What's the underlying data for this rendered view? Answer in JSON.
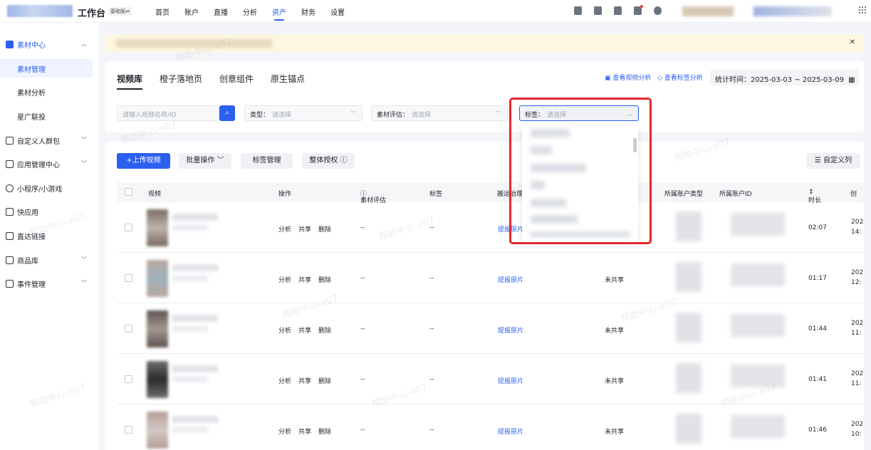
{
  "app": {
    "title": "工作台",
    "version_badge": "基础版⇌"
  },
  "nav": [
    "首页",
    "账户",
    "直播",
    "分析",
    "资产",
    "财务",
    "设置"
  ],
  "nav_active": "资产",
  "sidebar": {
    "items": [
      {
        "label": "素材中心",
        "icon": "material-icon",
        "expanded": true
      },
      {
        "label": "自定义人群包",
        "icon": "audience-icon"
      },
      {
        "label": "应用管理中心",
        "icon": "app-icon"
      },
      {
        "label": "小程序/小游戏",
        "icon": "miniapp-icon"
      },
      {
        "label": "快应用",
        "icon": "quickapp-icon"
      },
      {
        "label": "直达链接",
        "icon": "link-icon"
      },
      {
        "label": "商品库",
        "icon": "product-icon"
      },
      {
        "label": "事件管理",
        "icon": "event-icon"
      }
    ],
    "sub": [
      "素材管理",
      "素材分析",
      "星广联投"
    ],
    "sub_active": "素材管理"
  },
  "tabs": [
    "视频库",
    "橙子落地页",
    "创意组件",
    "原生锚点"
  ],
  "links": {
    "video_analysis": "查看视频分析",
    "tag_analysis": "查看标签分析"
  },
  "stat": {
    "label": "统计时间：",
    "range": "2025-03-03 ~ 2025-03-09"
  },
  "filters": {
    "search_placeholder": "请输入视频名称/ID",
    "type_label": "类型：",
    "type_value": "请选择",
    "eval_label": "素材评估：",
    "eval_value": "请选择",
    "tag_label": "标签：",
    "tag_value": "请选择"
  },
  "toolbar": {
    "upload": "+上传视频",
    "batch": "批量操作",
    "tag_manage": "标签管理",
    "authorize": "整体授权",
    "custom_cols": "自定义列"
  },
  "table": {
    "headers": {
      "video": "视频",
      "ops": "操作",
      "eval": "素材评估",
      "tag": "标签",
      "carry": "搬运治理",
      "acct_type": "所属账户类型",
      "acct_id": "所属账户ID",
      "duration": "时长",
      "created": "创"
    },
    "op_labels": {
      "analyze": "分析",
      "share": "共享",
      "delete": "删除"
    },
    "rows": [
      {
        "eval": "--",
        "tag": "--",
        "carry": "提报原片",
        "share_status": "",
        "duration": "02:07",
        "created1": "202",
        "created2": "14:"
      },
      {
        "eval": "--",
        "tag": "--",
        "carry": "提报原片",
        "share_status": "未共享",
        "duration": "01:17",
        "created1": "202",
        "created2": "12:"
      },
      {
        "eval": "--",
        "tag": "--",
        "carry": "提报原片",
        "share_status": "未共享",
        "duration": "01:44",
        "created1": "202",
        "created2": "11:"
      },
      {
        "eval": "--",
        "tag": "--",
        "carry": "提报原片",
        "share_status": "未共享",
        "duration": "01:41",
        "created1": "202",
        "created2": "11:"
      },
      {
        "eval": "--",
        "tag": "--",
        "carry": "提报原片",
        "share_status": "未共享",
        "duration": "01:46",
        "created1": "202",
        "created2": "10:"
      }
    ]
  },
  "watermark": "帮助中心-e07",
  "colors": {
    "primary": "#2b5ff0",
    "highlight_box": "#e8262a",
    "notice_bg": "#fff6e0"
  }
}
